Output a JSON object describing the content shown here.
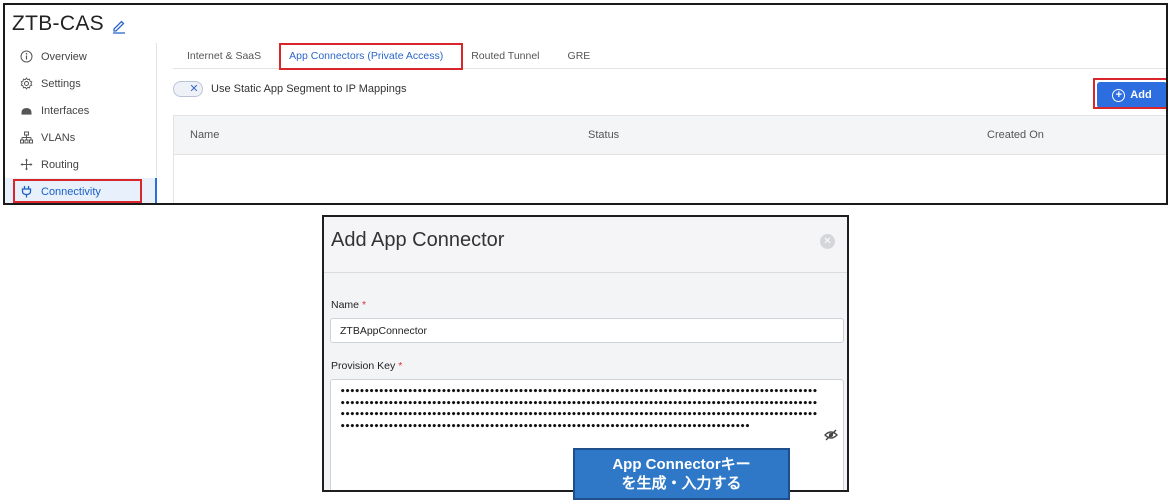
{
  "top": {
    "title": "ZTB-CAS",
    "sidebar": [
      {
        "label": "Overview",
        "icon": "info-icon"
      },
      {
        "label": "Settings",
        "icon": "gear-icon"
      },
      {
        "label": "Interfaces",
        "icon": "interfaces-icon"
      },
      {
        "label": "VLANs",
        "icon": "network-icon"
      },
      {
        "label": "Routing",
        "icon": "routing-arrows-icon"
      },
      {
        "label": "Connectivity",
        "icon": "plug-icon",
        "active": true
      }
    ],
    "tabs": [
      "Internet & SaaS",
      "App Connectors (Private Access)",
      "Routed Tunnel",
      "GRE"
    ],
    "active_tab": 1,
    "toggle_label": "Use Static App Segment to IP Mappings",
    "add_label": "Add",
    "table_headers": [
      "Name",
      "Status",
      "Created On"
    ]
  },
  "modal": {
    "title": "Add App Connector",
    "name_label": "Name",
    "name_value": "ZTBAppConnector",
    "key_label": "Provision Key",
    "required_mark": "*",
    "key_value": "••••••••••••••••••••••••••••••••••••••••••••••••••••••••••••••••••••••••••••••••••••••••••••••••••••••••••••••••••••••••••••••••••••••••••••••••••••••••••••••••••••••••••••••••••••••••••••••••••••••••••••••••••••••••••••••••••••••••••••••••••••••••••••••••••••••••••••••••••••••••••••••••••••••••••••••••••••••••••••••••••••••••••••••••••••••••••••••••••••••••••••••••••••••••••••••"
  },
  "callout": {
    "line1": "App Connectorキー",
    "line2": "を生成・入力する"
  },
  "colors": {
    "accent": "#2c6de0",
    "highlight": "#d9262a",
    "callout_bg": "#2f78c8"
  }
}
